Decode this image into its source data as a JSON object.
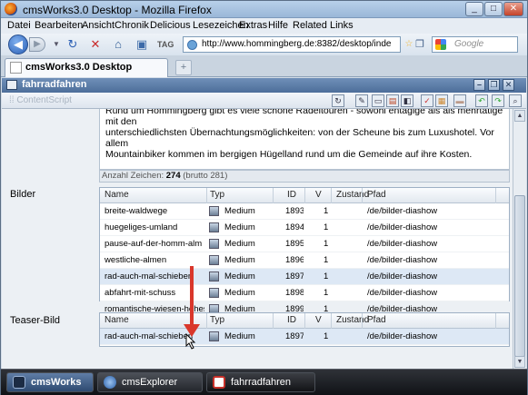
{
  "window": {
    "title": "cmsWorks3.0 Desktop - Mozilla Firefox",
    "controls": [
      "_",
      "□",
      "✕"
    ]
  },
  "menu": [
    "Datei",
    "Bearbeiten",
    "Ansicht",
    "Chronik",
    "Delicious",
    "Lesezeichen",
    "Extras",
    "Hilfe",
    "Related Links"
  ],
  "nav": {
    "url": "http://www.hommingberg.de:8382/desktop/inde",
    "search_placeholder": "Google"
  },
  "browser_tab": {
    "label": "cmsWorks3.0 Desktop",
    "new_tab": "+"
  },
  "app": {
    "title": "fahrradfahren",
    "content_script": "ContentScript"
  },
  "textbox": {
    "lines": [
      "Rund um Hommingberg gibt es viele schöne Radeltouren - sowohl entagige als als mehrtätige mit den",
      "unterschiedlichsten  Übernachtungsmöglichkeiten: von der Scheune bis zum Luxushotel. Vor allem",
      "Mountainbiker kommen im bergigen Hügelland rund um die Gemeinde auf ihre Kosten."
    ]
  },
  "charcount": {
    "label": "Anzahl Zeichen:",
    "count": "274",
    "brutto": "(brutto 281)"
  },
  "fields": {
    "bilder": "Bilder",
    "teaser": "Teaser-Bild"
  },
  "columns": {
    "name": "Name",
    "typ": "Typ",
    "id": "ID",
    "v": "V",
    "zustand": "Zustand",
    "pfad": "Pfad"
  },
  "bilder_rows": [
    {
      "name": "breite-waldwege",
      "typ": "Medium",
      "id": "1893",
      "v": "1",
      "pfad": "/de/bilder-diashow",
      "selected": false
    },
    {
      "name": "huegeliges-umland",
      "typ": "Medium",
      "id": "1894",
      "v": "1",
      "pfad": "/de/bilder-diashow",
      "selected": false
    },
    {
      "name": "pause-auf-der-homm-alm",
      "typ": "Medium",
      "id": "1895",
      "v": "1",
      "pfad": "/de/bilder-diashow",
      "selected": false
    },
    {
      "name": "westliche-almen",
      "typ": "Medium",
      "id": "1896",
      "v": "1",
      "pfad": "/de/bilder-diashow",
      "selected": false
    },
    {
      "name": "rad-auch-mal-schieben",
      "typ": "Medium",
      "id": "1897",
      "v": "1",
      "pfad": "/de/bilder-diashow",
      "selected": true
    },
    {
      "name": "abfahrt-mit-schuss",
      "typ": "Medium",
      "id": "1898",
      "v": "1",
      "pfad": "/de/bilder-diashow",
      "selected": false
    },
    {
      "name": "romantische-wiesen-hohes-gra",
      "typ": "Medium",
      "id": "1899",
      "v": "1",
      "pfad": "/de/bilder-diashow",
      "selected": false
    }
  ],
  "teaser_rows": [
    {
      "name": "rad-auch-mal-schieben",
      "typ": "Medium",
      "id": "1897",
      "v": "1",
      "pfad": "/de/bilder-diashow",
      "selected": true
    }
  ],
  "taskbar": {
    "cms": "cmsWorks",
    "explorer": "cmsExplorer",
    "doc": "fahrradfahren"
  },
  "colors": {
    "accent": "#4d6e9a",
    "arrow": "#d9372b",
    "selected_row": "#dde8f5"
  }
}
